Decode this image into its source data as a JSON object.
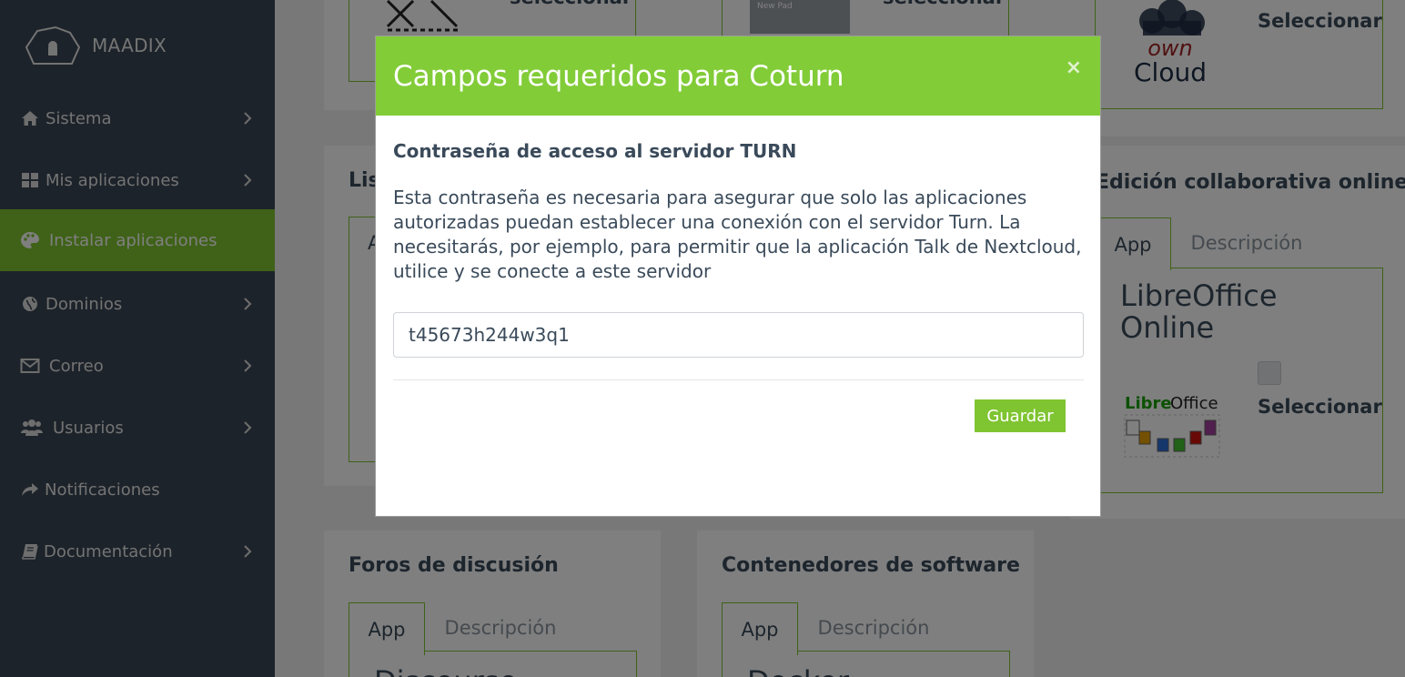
{
  "brand": {
    "name": "MAADIX"
  },
  "sidebar": {
    "items": [
      {
        "label": "Sistema",
        "icon": "home-icon",
        "has_chevron": true
      },
      {
        "label": "Mis aplicaciones",
        "icon": "grid-icon",
        "has_chevron": true
      },
      {
        "label": "Instalar aplicaciones",
        "icon": "palette-icon",
        "has_chevron": false,
        "active": true
      },
      {
        "label": "Dominios",
        "icon": "globe-icon",
        "has_chevron": true
      },
      {
        "label": "Correo",
        "icon": "envelope-icon",
        "has_chevron": true
      },
      {
        "label": "Usuarios",
        "icon": "users-icon",
        "has_chevron": true
      },
      {
        "label": "Notificaciones",
        "icon": "share-arrow-icon",
        "has_chevron": false
      },
      {
        "label": "Documentación",
        "icon": "book-icon",
        "has_chevron": true
      }
    ]
  },
  "background": {
    "top_row": {
      "select_label_partial": "seleccionar",
      "new_pad_label": "New Pad",
      "owncloud_select": "Seleccionar"
    },
    "list_panel": {
      "title_partial": "Lis",
      "tab_partial": "A"
    },
    "collab_panel": {
      "title": "Edición collaborativa online",
      "tabs": [
        "App",
        "Descripción"
      ],
      "app_name": "LibreOffice Online",
      "select_label": "Seleccionar"
    },
    "forums_panel": {
      "title": "Foros de discusión",
      "tabs": [
        "App",
        "Descripción"
      ],
      "app_partial": "Discourse"
    },
    "containers_panel": {
      "title": "Contenedores de software",
      "tabs": [
        "App",
        "Descripción"
      ],
      "app_partial": "Docker"
    }
  },
  "modal": {
    "title": "Campos requeridos para Coturn",
    "close_label": "×",
    "field_label": "Contraseña de acceso al servidor TURN",
    "help_text": "Esta contraseña es necesaria para asegurar que solo las aplicaciones autorizadas puedan establecer una conexión con el servidor Turn. La necesitarás, por ejemplo, para permitir que la aplicación Talk de Nextcloud, utilice y se conecte a este servidor",
    "input_value": "t45673h244w3q1",
    "save_label": "Guardar"
  },
  "colors": {
    "accent": "#7fc431",
    "header_green": "#82cc38",
    "sidebar_bg": "#3a4654",
    "text": "#3a4a5a"
  }
}
